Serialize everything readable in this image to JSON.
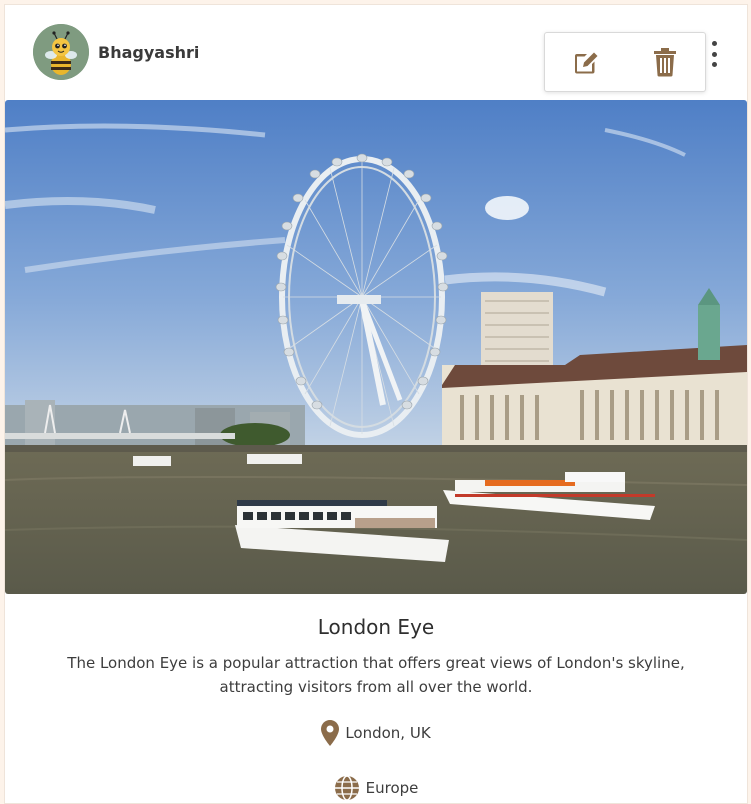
{
  "post": {
    "author": "Bhagyashri",
    "title": "London Eye",
    "description": "The London Eye is a popular attraction that offers great views of London's skyline, attracting visitors from all over the world.",
    "location": "London, UK",
    "region": "Europe"
  },
  "icons": {
    "edit": "edit-icon",
    "delete": "trash-icon",
    "menu": "kebab-icon",
    "location": "map-pin-icon",
    "region": "globe-icon"
  },
  "colors": {
    "accent": "#8b6c4a",
    "page_bg": "#fdf3ea",
    "avatar_bg": "#7f9b80"
  }
}
